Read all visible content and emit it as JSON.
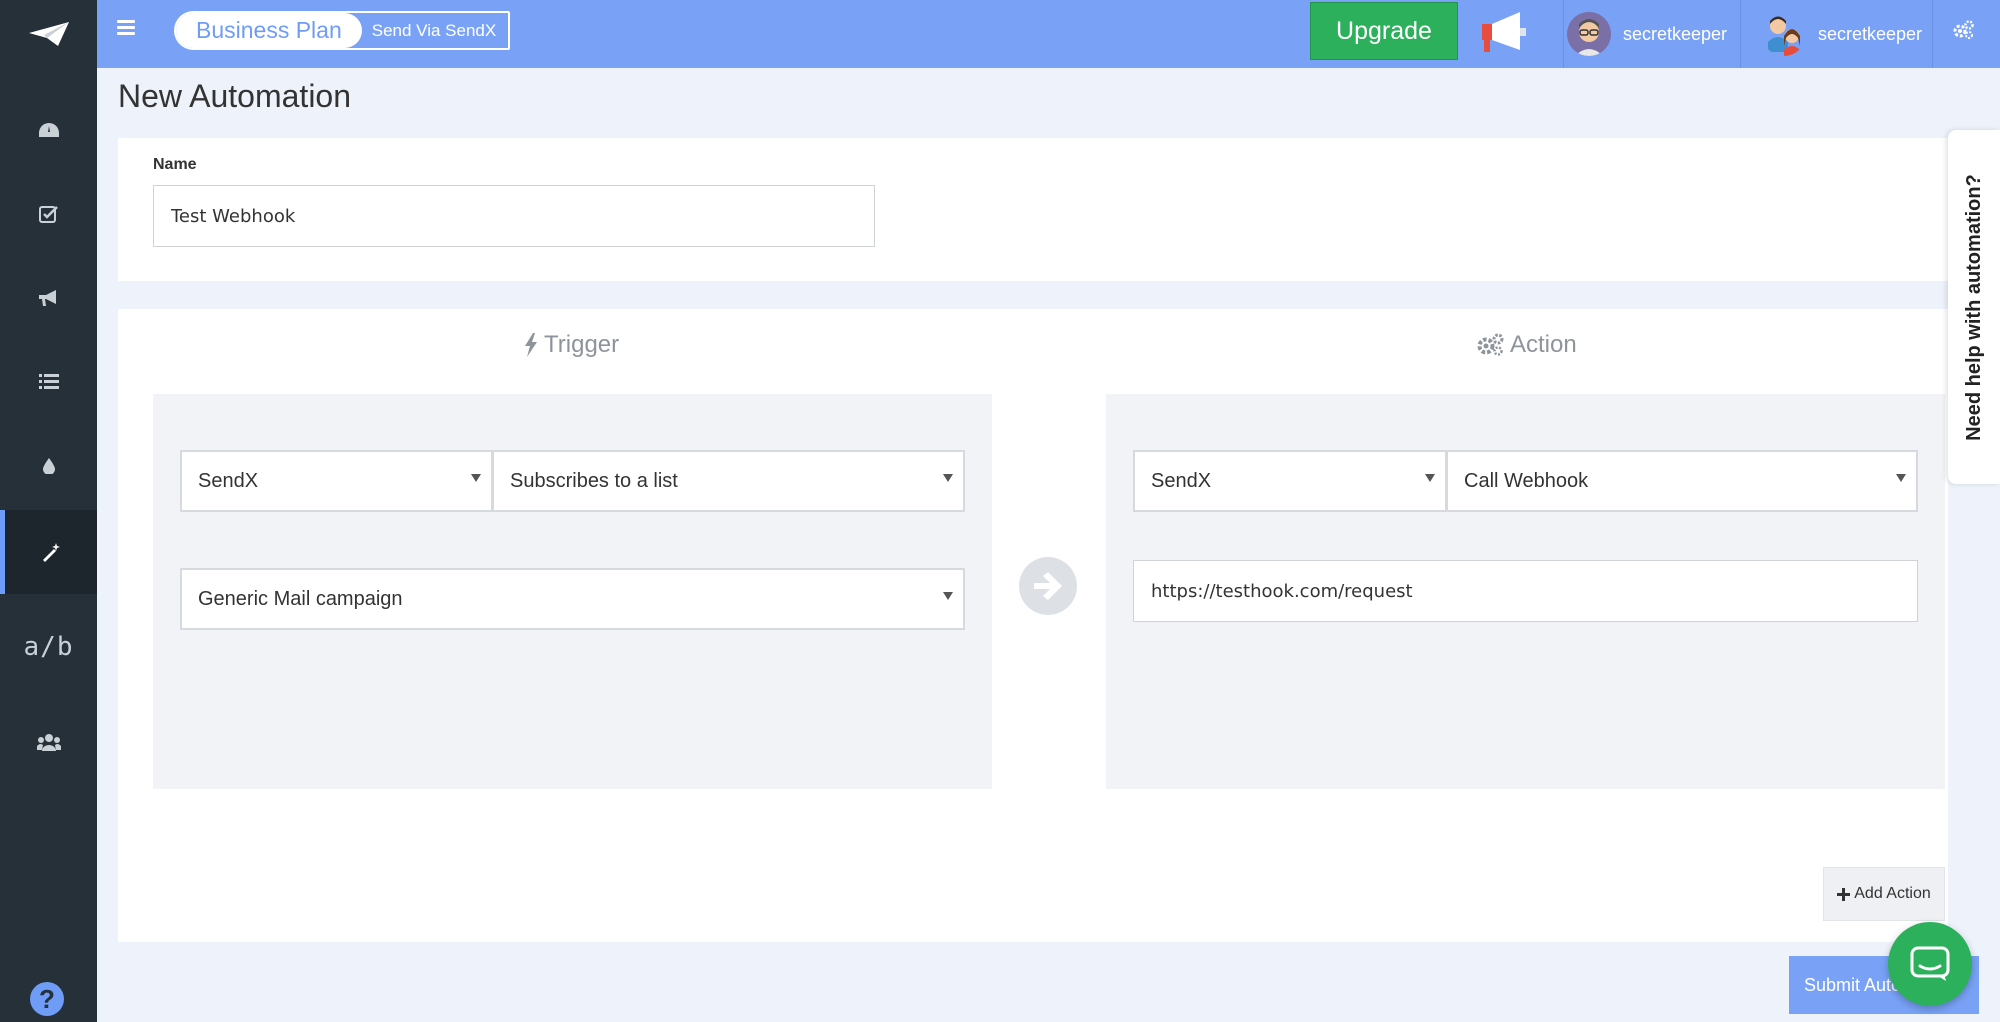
{
  "header": {
    "plan_label": "Business Plan",
    "send_via_label": "Send Via SendX",
    "upgrade_label": "Upgrade",
    "users": [
      {
        "name": "secretkeeper"
      },
      {
        "name": "secretkeeper"
      }
    ]
  },
  "sidebar": {
    "items": [
      {
        "icon": "dashboard-icon"
      },
      {
        "icon": "checkbox-icon"
      },
      {
        "icon": "megaphone-icon"
      },
      {
        "icon": "list-icon"
      },
      {
        "icon": "drop-icon"
      },
      {
        "icon": "magic-wand-icon",
        "active": true
      },
      {
        "label": "a/b"
      },
      {
        "icon": "users-icon"
      }
    ],
    "help_label": "?"
  },
  "page": {
    "title": "New Automation"
  },
  "name_field": {
    "label": "Name",
    "value": "Test Webhook"
  },
  "trigger": {
    "title": "Trigger",
    "source": "SendX",
    "event": "Subscribes to a list",
    "list": "Generic Mail campaign"
  },
  "action": {
    "title": "Action",
    "source": "SendX",
    "type": "Call Webhook",
    "url": "https://testhook.com/request"
  },
  "buttons": {
    "add_action": "Add Action",
    "submit": "Submit Automation"
  },
  "help_tab": {
    "label": "Need help with automation?"
  },
  "colors": {
    "accent": "#79a2f7",
    "sidebar": "#253039",
    "upgrade": "#2cb05b"
  }
}
